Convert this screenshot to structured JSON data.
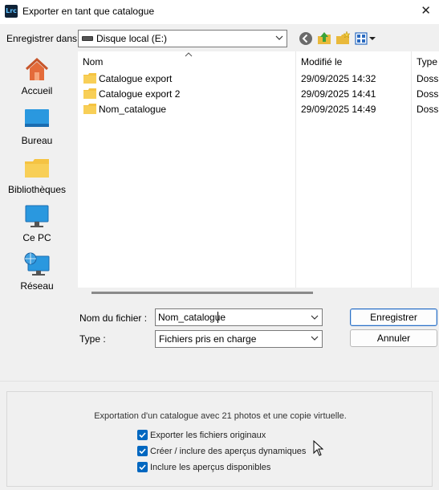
{
  "window": {
    "title": "Exporter en tant que catalogue",
    "app_icon_text": "Lrc",
    "close_glyph": "✕"
  },
  "toolbar": {
    "save_in_label": "Enregistrer dans :",
    "location_value": "Disque local (E:)",
    "icons": [
      "back-icon",
      "up-folder-icon",
      "new-folder-icon",
      "view-menu-icon"
    ]
  },
  "places": [
    {
      "label": "Accueil",
      "icon": "home-icon"
    },
    {
      "label": "Bureau",
      "icon": "desktop-icon"
    },
    {
      "label": "Bibliothèques",
      "icon": "libraries-icon"
    },
    {
      "label": "Ce PC",
      "icon": "this-pc-icon"
    },
    {
      "label": "Réseau",
      "icon": "network-icon"
    }
  ],
  "file_list": {
    "columns": [
      "Nom",
      "Modifié le",
      "Type"
    ],
    "rows": [
      {
        "name": "Catalogue export",
        "modified": "29/09/2025 14:32",
        "type": "Dossi"
      },
      {
        "name": "Catalogue export 2",
        "modified": "29/09/2025 14:41",
        "type": "Dossi"
      },
      {
        "name": "Nom_catalogue",
        "modified": "29/09/2025 14:49",
        "type": "Dossi"
      }
    ]
  },
  "form": {
    "filename_label": "Nom du fichier :",
    "filename_value": "Nom_catalogue",
    "type_label": "Type :",
    "type_value": "Fichiers pris en charge",
    "save_button": "Enregistrer",
    "cancel_button": "Annuler"
  },
  "options": {
    "summary": "Exportation d'un catalogue avec 21 photos et une copie virtuelle.",
    "checkboxes": [
      {
        "label": "Exporter les fichiers originaux",
        "checked": true
      },
      {
        "label": "Créer / inclure des aperçus dynamiques",
        "checked": true
      },
      {
        "label": "Inclure les aperçus disponibles",
        "checked": true
      }
    ]
  },
  "colors": {
    "accent": "#0067c0",
    "folder": "#f5c342"
  }
}
